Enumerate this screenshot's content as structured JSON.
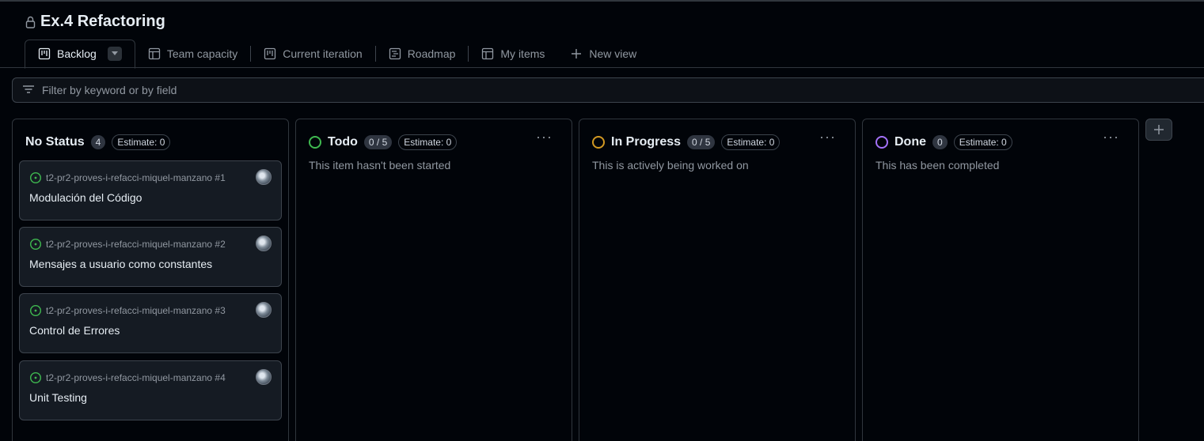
{
  "project": {
    "title": "Ex.4 Refactoring"
  },
  "tabs": [
    {
      "label": "Backlog",
      "icon": "board-icon",
      "active": true
    },
    {
      "label": "Team capacity",
      "icon": "table-icon"
    },
    {
      "label": "Current iteration",
      "icon": "board-icon"
    },
    {
      "label": "Roadmap",
      "icon": "roadmap-icon"
    },
    {
      "label": "My items",
      "icon": "table-icon"
    }
  ],
  "new_view_label": "New view",
  "filter": {
    "placeholder": "Filter by keyword or by field"
  },
  "columns": [
    {
      "title": "No Status",
      "count": "4",
      "estimate": "Estimate: 0",
      "cards": [
        {
          "repo": "t2-pr2-proves-i-refacci-miquel-manzano #1",
          "title": "Modulación del Código"
        },
        {
          "repo": "t2-pr2-proves-i-refacci-miquel-manzano #2",
          "title": "Mensajes a usuario como constantes"
        },
        {
          "repo": "t2-pr2-proves-i-refacci-miquel-manzano #3",
          "title": "Control de Errores"
        },
        {
          "repo": "t2-pr2-proves-i-refacci-miquel-manzano #4",
          "title": "Unit Testing"
        }
      ]
    },
    {
      "title": "Todo",
      "count": "0 / 5",
      "estimate": "Estimate: 0",
      "description": "This item hasn't been started",
      "color": "#3fb950"
    },
    {
      "title": "In Progress",
      "count": "0 / 5",
      "estimate": "Estimate: 0",
      "description": "This is actively being worked on",
      "color": "#d29922"
    },
    {
      "title": "Done",
      "count": "0",
      "estimate": "Estimate: 0",
      "description": "This has been completed",
      "color": "#a371f7"
    }
  ],
  "colors": {
    "background": "#010409",
    "card": "#151b23",
    "border": "#3d444d",
    "open_issue": "#3fb950"
  }
}
